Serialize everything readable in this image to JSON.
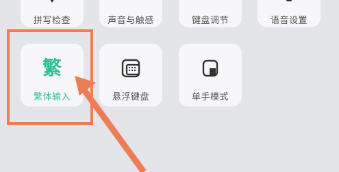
{
  "top_row": [
    {
      "label": "拼写检查",
      "icon": "spellcheck-icon"
    },
    {
      "label": "声音与触感",
      "icon": "sound-icon"
    },
    {
      "label": "键盘调节",
      "icon": "keyboard-adjust-icon"
    },
    {
      "label": "语音设置",
      "icon": "voice-settings-icon"
    }
  ],
  "second_row": [
    {
      "label": "繁体输入",
      "glyph": "繁",
      "icon": "traditional-chinese-icon"
    },
    {
      "label": "悬浮键盘",
      "icon": "floating-keyboard-icon"
    },
    {
      "label": "单手模式",
      "icon": "one-hand-mode-icon"
    }
  ],
  "colors": {
    "accent_green": "#2fc090",
    "highlight_orange": "#ee7c55"
  }
}
